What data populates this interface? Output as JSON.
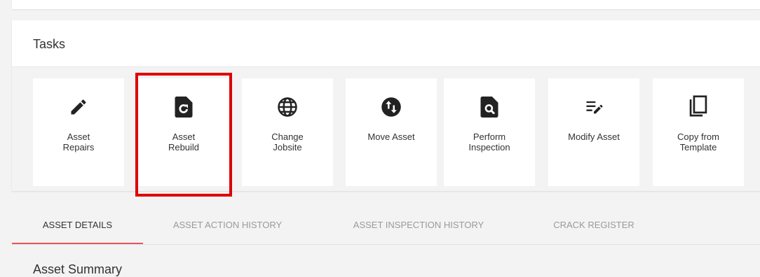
{
  "tasks": {
    "title": "Tasks",
    "items": [
      {
        "label": "Asset\nRepairs",
        "icon": "pencil-icon"
      },
      {
        "label": "Asset\nRebuild",
        "icon": "rebuild-file-icon"
      },
      {
        "label": "Change\nJobsite",
        "icon": "globe-icon"
      },
      {
        "label": "Move Asset",
        "icon": "move-arrows-icon"
      },
      {
        "label": "Perform\nInspection",
        "icon": "inspection-search-icon"
      },
      {
        "label": "Modify Asset",
        "icon": "edit-list-icon"
      },
      {
        "label": "Copy from\nTemplate",
        "icon": "copy-icon"
      }
    ]
  },
  "tabs": [
    {
      "label": "ASSET DETAILS",
      "active": true
    },
    {
      "label": "ASSET ACTION HISTORY",
      "active": false
    },
    {
      "label": "ASSET INSPECTION HISTORY",
      "active": false
    },
    {
      "label": "CRACK REGISTER",
      "active": false
    }
  ],
  "section": {
    "title": "Asset Summary"
  },
  "colors": {
    "highlight": "#e00000",
    "active_tab_underline": "#e8525e"
  }
}
